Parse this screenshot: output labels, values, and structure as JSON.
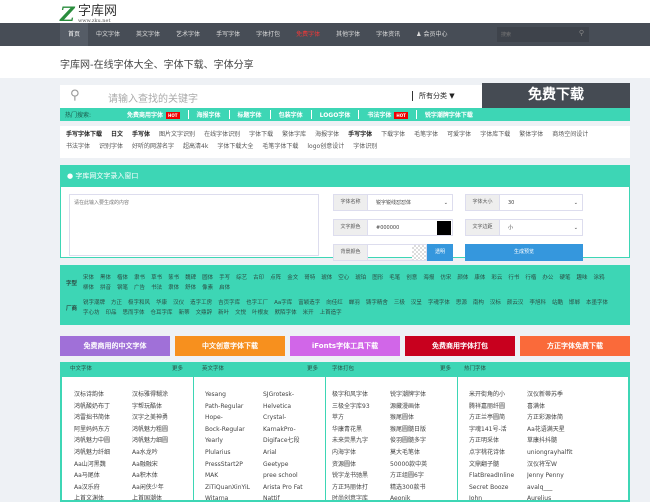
{
  "logo": {
    "name": "字库网",
    "url": "www.zku.net"
  },
  "nav": {
    "items": [
      "首页",
      "中文字体",
      "英文字体",
      "艺术字体",
      "手写字体",
      "字体打包",
      "免费字体",
      "其他字体",
      "字体资讯",
      "会员中心"
    ],
    "search_placeholder": "搜索"
  },
  "title": "字库网-在线字体大全、字体下载、字体分享",
  "search": {
    "placeholder": "请输入查找的关键字",
    "category": "所有分类",
    "button": "免费下载"
  },
  "hot": {
    "label": "热门搜索:",
    "items": [
      "免费商用字体",
      "海报字体",
      "标题字体",
      "包装字体",
      "LOGO字体",
      "书法字体",
      "锐字潮牌字体下载"
    ],
    "hot_badge": "HOT"
  },
  "tags": [
    "手写字体下载",
    "日文",
    "手写体",
    "图片文字识别",
    "在线字体识别",
    "字体下载",
    "繁体字库",
    "海报字体",
    "手写字体",
    "下载字体",
    "毛笔字体",
    "可爱字体",
    "字体库下载",
    "繁体字体",
    "商场空间设计",
    "书法字体",
    "识别字体",
    "好听的网游名字",
    "超高清4k",
    "字体下载大全",
    "毛笔字体下载",
    "logo创意设计",
    "字体识别"
  ],
  "panel": {
    "title": "字库网文字录入窗口",
    "textarea_placeholder": "请在此输入要生成的内容",
    "font_name_label": "字体名称",
    "font_name": "锐字锐线怼怼体",
    "font_size_label": "字体大小",
    "font_size": "30",
    "color_label": "文字颜色",
    "color": "#000000",
    "spacing_label": "文字边距",
    "spacing": "小",
    "bg_label": "背景颜色",
    "transparent": "透明",
    "generate": "生成预览"
  },
  "cats": {
    "type_label": "字型",
    "types": [
      "宋体",
      "黑体",
      "楷体",
      "隶书",
      "草书",
      "篆书",
      "魏碑",
      "圆体",
      "手写",
      "综艺",
      "古印",
      "点阵",
      "金文",
      "哥特",
      "琥体",
      "空心",
      "琥珀",
      "图形",
      "毛笔",
      "创意",
      "海报",
      "仿宋",
      "颜体",
      "康体",
      "彩云",
      "行书",
      "行楷",
      "办公",
      "硬笔",
      "趣味",
      "涂鸦",
      "柳体",
      "拼音",
      "钢笔",
      "广告",
      "书法",
      "隶体",
      "舒体",
      "像素",
      "启体"
    ],
    "maker_label": "厂商",
    "makers": [
      "锐字潮牌",
      "方正",
      "极字和风",
      "华康",
      "汉仪",
      "造字工房",
      "吉页字库",
      "也字工厂",
      "Aa字库",
      "富颖造字",
      "向佳红",
      "蝉羽",
      "铸字精舍",
      "三极",
      "汉呈",
      "字魂字体",
      "思源",
      "南构",
      "汉标",
      "颜云汉",
      "李旭科",
      "站酷",
      "邯郸",
      "本墨字体",
      "字心坊",
      "印品",
      "思而字体",
      "仓耳字库",
      "新蒂",
      "文鼎辞",
      "新叶",
      "文悦",
      "叶根友",
      "默陌字体",
      "米开",
      "上首造字"
    ]
  },
  "banners": [
    "免费商用的中文字体",
    "中文创意字体下载",
    "iFonts字体工具下载",
    "免费商用字体打包",
    "方正字体免费下载"
  ],
  "lists": {
    "more": "更多",
    "headers": [
      "中文字体",
      "英文字体",
      "字体打包",
      "热门字体"
    ],
    "chinese": [
      "汉标诗韵体",
      "汉标雅得糊涂",
      "鸿帆酸奶布丁",
      "字帮玩酷体",
      "鸿雷拙书简体",
      "汉字之美神勇",
      "阿里妈妈东方",
      "鸿帆魅力粗圆",
      "鸿帆魅力中圆",
      "鸿帆魅力细圆",
      "鸿帆魅力纤细",
      "Aa水龙吟",
      "Aa山河黑魏",
      "Aa融融宋",
      "Aa马尾体",
      "Aa积木体",
      "Aa汉乐府",
      "Aa闲侠少年",
      "上首文渊体",
      "上首国潮体"
    ],
    "english": [
      "Yesang",
      "SJGrotesk-",
      "Path-Regular",
      "Helvetica",
      "Hope-",
      "Crystal-",
      "Bock-Regular",
      "KarnakPro-",
      "Yearly",
      "Digiface七段",
      "Plularius",
      "Arial",
      "PressStart2P",
      "Geetype",
      "MAK",
      "pree school",
      "ZiTiQuanXinYiL",
      "Arista Pro Fat",
      "Witarna",
      "Nattif"
    ],
    "packs": [
      "极字和风字体",
      "锐字潮牌字体",
      "三极全字库93",
      "源藏漫画体",
      "苹方",
      "猴尾圆体",
      "华康青花黑",
      "猴尾圆髓日版",
      "未来荧黑九字",
      "俊羽圆髓多字",
      "内海字体",
      "莫大毛笔体",
      "资源圆体",
      "50000款中英",
      "锐字龙书驰黑",
      "方正组圆6字",
      "方正玛丽体打",
      "精选300款书",
      "时尚创意字库",
      "Aeonik"
    ],
    "hot": [
      "米开街角的小",
      "汉仪新蒂苏季",
      "腾祥嘉丽纤圆",
      "喜满体",
      "方正兰亭圆简",
      "方正彩源体简",
      "字魂141号-活",
      "Aa花语满天星",
      "方正明采体",
      "草康抖抖髓",
      "点字桃花诗体",
      "uniongrayhalfit",
      "文鼎翻子髓",
      "汉仪将军W",
      "FlatBreadInline",
      "Jenny Penny",
      "Secret Booze",
      "avalq___",
      "John",
      "Aurelius"
    ]
  },
  "colors": {
    "teal": "#3dd6b5",
    "nav": "#474d56",
    "blue": "#3597dd"
  }
}
